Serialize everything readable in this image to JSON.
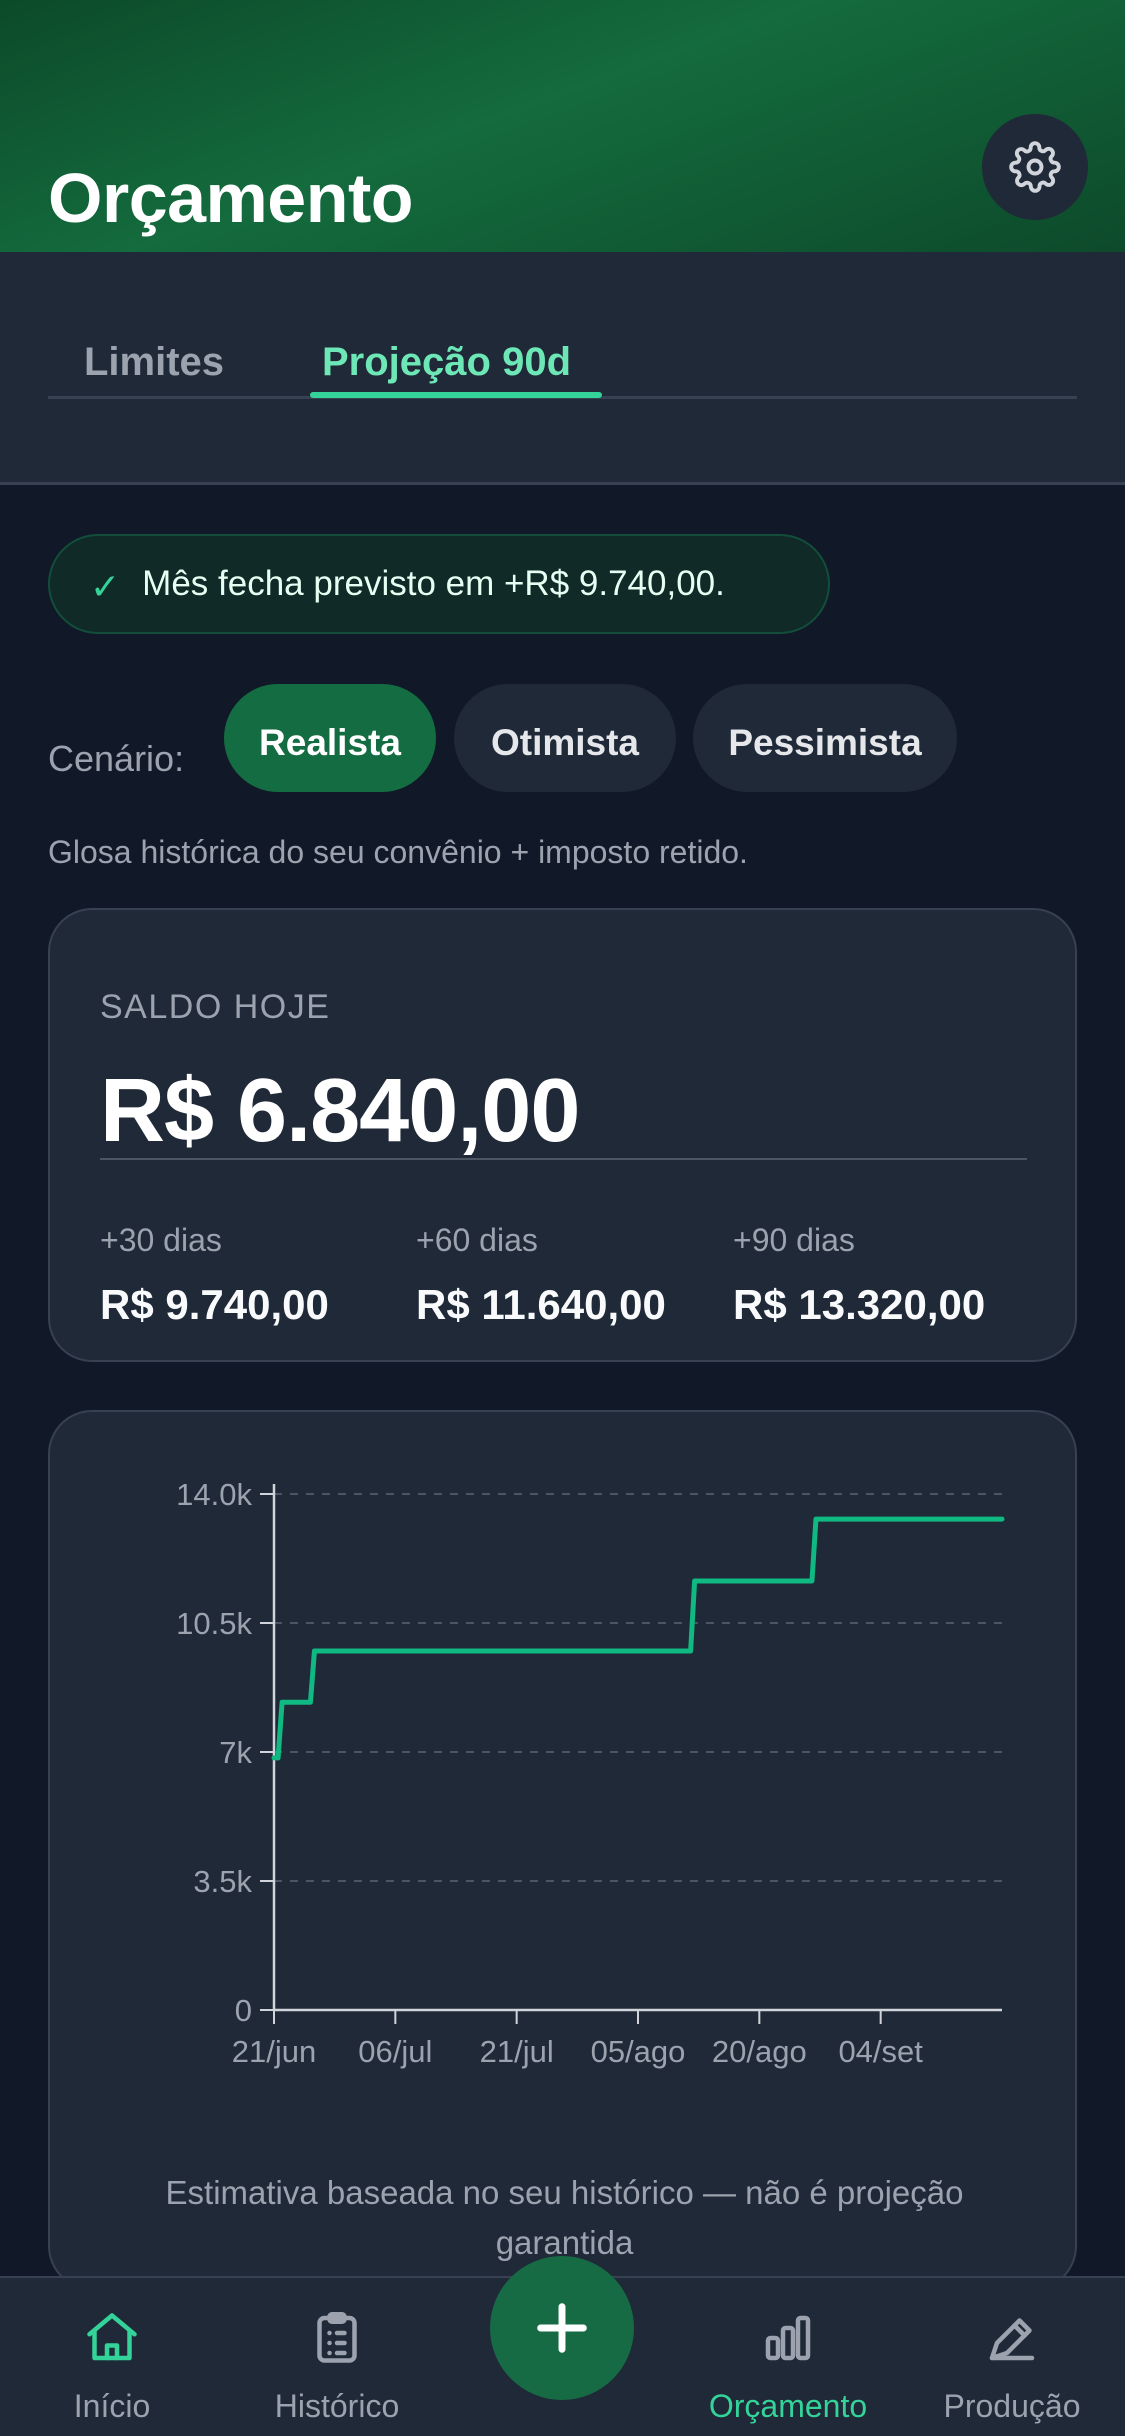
{
  "header": {
    "title": "Orçamento",
    "settings_icon": "gear-icon"
  },
  "tabs": [
    {
      "label": "Limites",
      "active": false
    },
    {
      "label": "Projeção 90d",
      "active": true
    }
  ],
  "banner": {
    "icon": "check-icon",
    "text": "Mês fecha previsto em +R$ 9.740,00."
  },
  "scenario": {
    "label": "Cenário:",
    "options": [
      "Realista",
      "Otimista",
      "Pessimista"
    ],
    "selected": "Realista",
    "description": "Glosa histórica do seu convênio + imposto retido."
  },
  "balance": {
    "label": "SALDO HOJE",
    "value": "R$ 6.840,00",
    "projections": [
      {
        "label": "+30 dias",
        "value": "R$ 9.740,00"
      },
      {
        "label": "+60 dias",
        "value": "R$ 11.640,00"
      },
      {
        "label": "+90 dias",
        "value": "R$ 13.320,00"
      }
    ]
  },
  "chart_data": {
    "type": "line",
    "title": "",
    "xlabel": "",
    "ylabel": "",
    "x_ticks": [
      "21/jun",
      "06/jul",
      "21/jul",
      "05/ago",
      "20/ago",
      "04/set"
    ],
    "y_ticks": [
      "0",
      "3.5k",
      "7k",
      "10.5k",
      "14.0k"
    ],
    "ylim": [
      0,
      14000
    ],
    "xlim_days": [
      0,
      90
    ],
    "grid": true,
    "series": [
      {
        "color": "#10b981",
        "step": true,
        "points": [
          {
            "day": 0,
            "value": 6840
          },
          {
            "day": 1,
            "value": 8350
          },
          {
            "day": 5,
            "value": 9740
          },
          {
            "day": 52,
            "value": 11640
          },
          {
            "day": 67,
            "value": 13320
          },
          {
            "day": 90,
            "value": 13320
          }
        ]
      }
    ],
    "note": "Estimativa baseada no seu histórico — não é projeção garantida"
  },
  "nav": {
    "items": [
      {
        "label": "Início",
        "icon": "home-icon",
        "active": false
      },
      {
        "label": "Histórico",
        "icon": "clipboard-icon",
        "active": false
      },
      {
        "label": "Orçamento",
        "icon": "bar-chart-icon",
        "active": true
      },
      {
        "label": "Produção",
        "icon": "pen-icon",
        "active": false
      }
    ],
    "fab_icon": "plus-icon"
  }
}
